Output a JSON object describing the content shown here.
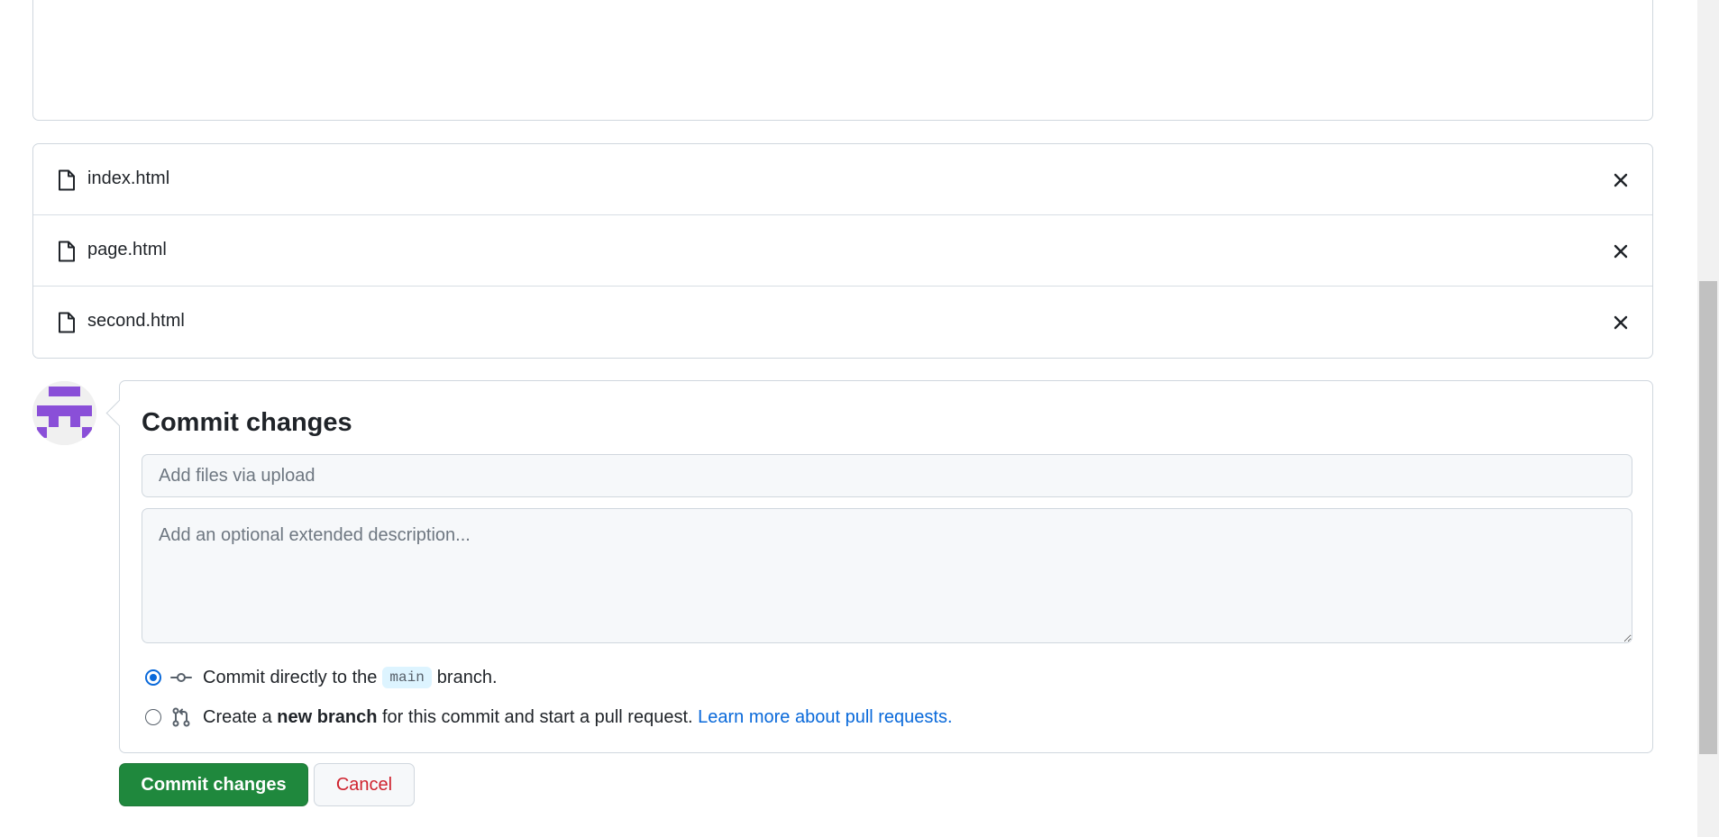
{
  "files": [
    {
      "name": "index.html",
      "icon": "file-icon",
      "remove_icon": "close-icon"
    },
    {
      "name": "page.html",
      "icon": "file-icon",
      "remove_icon": "close-icon"
    },
    {
      "name": "second.html",
      "icon": "file-icon",
      "remove_icon": "close-icon"
    }
  ],
  "commit": {
    "title": "Commit changes",
    "summary_placeholder": "Add files via upload",
    "summary_value": "",
    "description_placeholder": "Add an optional extended description...",
    "description_value": "",
    "options": {
      "direct": {
        "selected": true,
        "text_before": "Commit directly to the",
        "branch": "main",
        "text_after": "branch.",
        "icon": "git-commit-icon"
      },
      "new_branch": {
        "selected": false,
        "text_before": "Create a",
        "bold": "new branch",
        "text_after": "for this commit and start a pull request.",
        "link": "Learn more about pull requests.",
        "icon": "git-pull-request-icon"
      }
    }
  },
  "buttons": {
    "commit": "Commit changes",
    "cancel": "Cancel"
  },
  "colors": {
    "primary_button": "#1f883d",
    "cancel_text": "#cf222e",
    "link": "#0969da",
    "avatar": "#8a4fd8"
  },
  "avatar_icon": "identicon-avatar"
}
